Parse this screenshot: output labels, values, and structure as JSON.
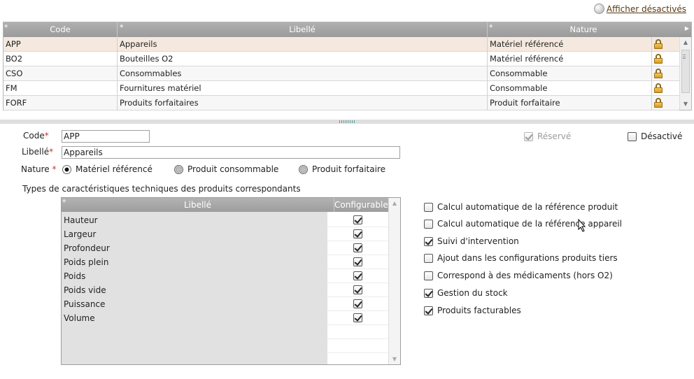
{
  "header": {
    "show_disabled_link": "Afficher désactivés"
  },
  "grid": {
    "columns": [
      "Code",
      "Libellé",
      "Nature"
    ],
    "rows": [
      {
        "code": "APP",
        "libelle": "Appareils",
        "nature": "Matériel référencé"
      },
      {
        "code": "BO2",
        "libelle": "Bouteilles O2",
        "nature": "Matériel référencé"
      },
      {
        "code": "CSO",
        "libelle": "Consommables",
        "nature": "Consommable"
      },
      {
        "code": "FM",
        "libelle": "Fournitures matériel",
        "nature": "Consommable"
      },
      {
        "code": "FORF",
        "libelle": "Produits forfaitaires",
        "nature": "Produit forfaitaire"
      }
    ]
  },
  "form": {
    "code_label": "Code",
    "code_value": "APP",
    "libelle_label": "Libellé",
    "libelle_value": "Appareils",
    "required_mark": "*",
    "nature_label": "Nature",
    "nature_options": [
      {
        "label": "Matériel référencé",
        "selected": true
      },
      {
        "label": "Produit consommable",
        "selected": false
      },
      {
        "label": "Produit forfaitaire",
        "selected": false
      }
    ],
    "reserve_label": "Réservé",
    "reserve_checked": true,
    "desactive_label": "Désactivé",
    "desactive_checked": false,
    "types_label": "Types de caractéristiques techniques des produits correspondants"
  },
  "subgrid": {
    "columns": [
      "Libellé",
      "Configurable"
    ],
    "rows": [
      {
        "name": "Hauteur",
        "configurable": true
      },
      {
        "name": "Largeur",
        "configurable": true
      },
      {
        "name": "Profondeur",
        "configurable": true
      },
      {
        "name": "Poids plein",
        "configurable": true
      },
      {
        "name": "Poids",
        "configurable": true
      },
      {
        "name": "Poids vide",
        "configurable": true
      },
      {
        "name": "Puissance",
        "configurable": true
      },
      {
        "name": "Volume",
        "configurable": true
      }
    ]
  },
  "options": [
    {
      "label": "Calcul automatique de la référence produit",
      "checked": false
    },
    {
      "label": "Calcul automatique de la référence appareil",
      "checked": false
    },
    {
      "label": "Suivi d'intervention",
      "checked": true
    },
    {
      "label": "Ajout dans les configurations produits tiers",
      "checked": false
    },
    {
      "label": "Correspond à des médicaments (hors O2)",
      "checked": false
    },
    {
      "label": "Gestion du stock",
      "checked": true
    },
    {
      "label": "Produits facturables",
      "checked": true
    }
  ]
}
